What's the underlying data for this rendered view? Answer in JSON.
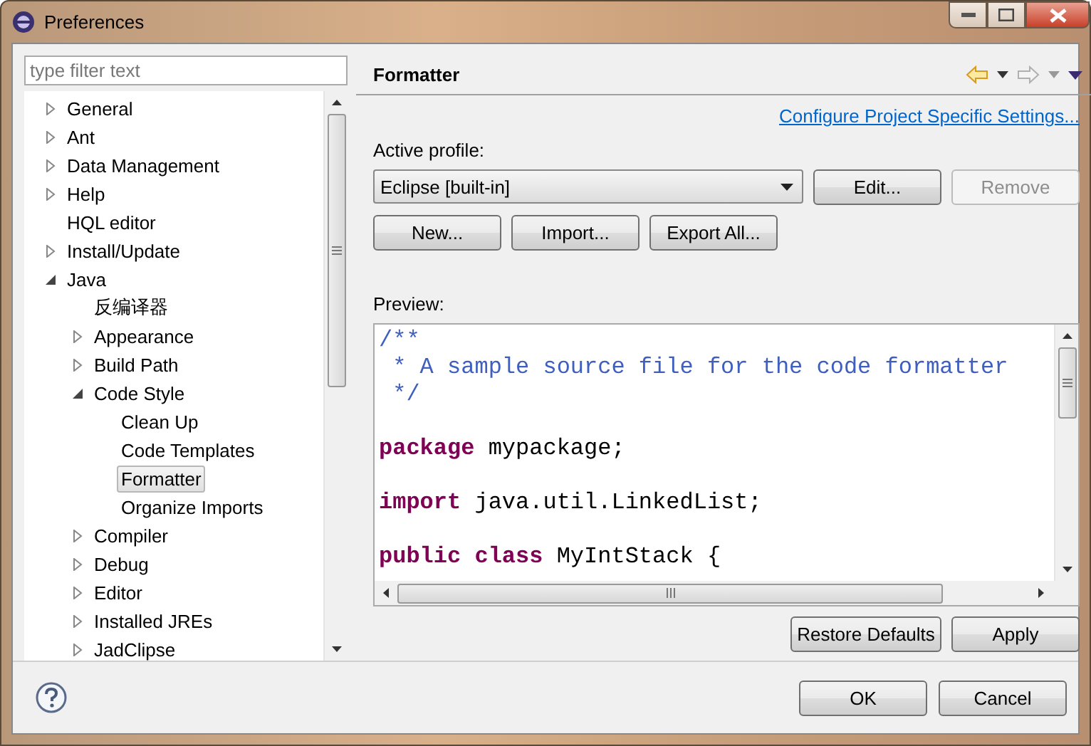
{
  "window": {
    "title": "Preferences"
  },
  "filter": {
    "placeholder": "type filter text"
  },
  "tree": [
    {
      "label": "General",
      "kind": "node",
      "expanded": false,
      "selected": false
    },
    {
      "label": "Ant",
      "kind": "node",
      "expanded": false,
      "selected": false
    },
    {
      "label": "Data Management",
      "kind": "node",
      "expanded": false,
      "selected": false
    },
    {
      "label": "Help",
      "kind": "node",
      "expanded": false,
      "selected": false
    },
    {
      "label": "HQL editor",
      "kind": "leaf",
      "selected": false
    },
    {
      "label": "Install/Update",
      "kind": "node",
      "expanded": false,
      "selected": false
    },
    {
      "label": "Java",
      "kind": "node",
      "expanded": true,
      "selected": false,
      "children": [
        {
          "label": "反编译器",
          "kind": "leaf",
          "selected": false
        },
        {
          "label": "Appearance",
          "kind": "node",
          "expanded": false,
          "selected": false
        },
        {
          "label": "Build Path",
          "kind": "node",
          "expanded": false,
          "selected": false
        },
        {
          "label": "Code Style",
          "kind": "node",
          "expanded": true,
          "selected": false,
          "children": [
            {
              "label": "Clean Up",
              "kind": "leaf",
              "selected": false
            },
            {
              "label": "Code Templates",
              "kind": "leaf",
              "selected": false
            },
            {
              "label": "Formatter",
              "kind": "leaf",
              "selected": true
            },
            {
              "label": "Organize Imports",
              "kind": "leaf",
              "selected": false
            }
          ]
        },
        {
          "label": "Compiler",
          "kind": "node",
          "expanded": false,
          "selected": false
        },
        {
          "label": "Debug",
          "kind": "node",
          "expanded": false,
          "selected": false
        },
        {
          "label": "Editor",
          "kind": "node",
          "expanded": false,
          "selected": false
        },
        {
          "label": "Installed JREs",
          "kind": "node",
          "expanded": false,
          "selected": false
        },
        {
          "label": "JadClipse",
          "kind": "node",
          "expanded": false,
          "selected": false
        }
      ]
    }
  ],
  "page": {
    "title": "Formatter",
    "link": "Configure Project Specific Settings...",
    "profile_label": "Active profile:",
    "profile": "Eclipse [built-in]",
    "profile_buttons": [
      {
        "label": "Edit...",
        "disabled": false
      },
      {
        "label": "Remove",
        "disabled": true
      }
    ],
    "buttons": [
      "New...",
      "Import...",
      "Export All..."
    ],
    "preview_label": "Preview:",
    "preview": [
      {
        "kind": "code",
        "segments": [
          {
            "kind": "comment",
            "text": "/**"
          }
        ]
      },
      {
        "kind": "code",
        "segments": [
          {
            "kind": "comment",
            "text": " * A sample source file for the code formatter"
          }
        ]
      },
      {
        "kind": "code",
        "segments": [
          {
            "kind": "comment",
            "text": " */"
          }
        ]
      },
      {
        "kind": "blank"
      },
      {
        "kind": "code",
        "segments": [
          {
            "kind": "keyword",
            "text": "package"
          },
          {
            "kind": "plain",
            "text": " mypackage;"
          }
        ]
      },
      {
        "kind": "blank"
      },
      {
        "kind": "code",
        "segments": [
          {
            "kind": "keyword",
            "text": "import"
          },
          {
            "kind": "plain",
            "text": " java.util.LinkedList;"
          }
        ]
      },
      {
        "kind": "blank"
      },
      {
        "kind": "code",
        "segments": [
          {
            "kind": "keyword",
            "text": "public class"
          },
          {
            "kind": "plain",
            "text": " MyIntStack {"
          }
        ]
      }
    ],
    "page_buttons": [
      "Restore Defaults",
      "Apply"
    ]
  },
  "dialog_buttons": [
    "OK",
    "Cancel"
  ]
}
